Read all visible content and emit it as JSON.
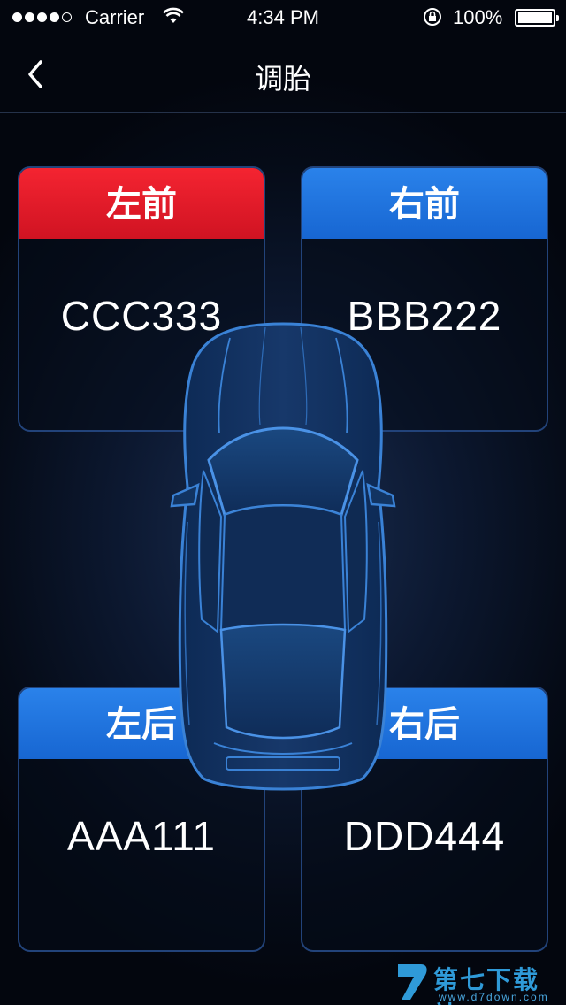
{
  "status_bar": {
    "carrier": "Carrier",
    "time": "4:34 PM",
    "battery": "100%"
  },
  "nav": {
    "title": "调胎"
  },
  "tires": {
    "front_left": {
      "label": "左前",
      "value": "CCC333"
    },
    "front_right": {
      "label": "右前",
      "value": "BBB222"
    },
    "rear_left": {
      "label": "左后",
      "value": "AAA111"
    },
    "rear_right": {
      "label": "右后",
      "value": "DDD444"
    }
  },
  "watermark": {
    "text": "第七下载站",
    "url": "www.d7down.com"
  },
  "colors": {
    "alert_red": "#e8192a",
    "header_blue": "#1f74e0",
    "background": "#050b17"
  }
}
